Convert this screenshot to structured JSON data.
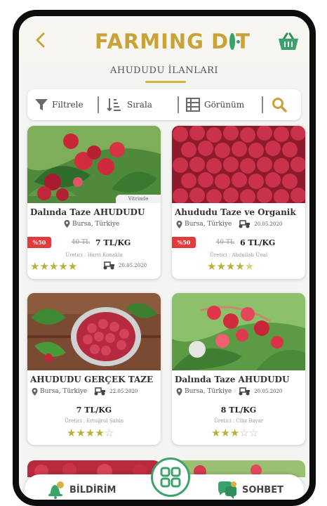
{
  "header": {
    "logo_part1": "FARMING",
    "logo_part2": "D",
    "logo_part3": "T"
  },
  "subtitle": "AHUDUDU İLANLARI",
  "toolbar": {
    "filter_label": "Filtrele",
    "sort_label": "Sırala",
    "view_label": "Görünüm"
  },
  "listings": [
    {
      "title": "Dalında Taze AHUDUDU",
      "location": "Bursa, Türkiye",
      "badge": "%50",
      "old_price": "40 TL",
      "price": "7 TL/KG",
      "seller": "Üretici : Harri Konakla",
      "date": "20.05.2020",
      "rating": 5,
      "showcase_label": "Vitrinde"
    },
    {
      "title": "Ahududu Taze ve Organik",
      "location": "Bursa, Türkiye",
      "badge": "%50",
      "old_price": "40 TL",
      "price": "6 TL/KG",
      "seller": "Üretici : Abdullah Ünal",
      "date": "20.05.2020",
      "rating": 4.5
    },
    {
      "title": "AHUDUDU GERÇEK TAZE",
      "location": "Bursa, Türkiye",
      "price": "7 TL/KG",
      "seller": "Üretici : Ertuğrul Şahin",
      "date": "22.05.2020",
      "rating": 4
    },
    {
      "title": "Dalında Taze AHUDUDU",
      "location": "Bursa, Türkiye",
      "price": "8 TL/KG",
      "seller": "Üretici : Cihz Bayar",
      "date": "20.05.2020",
      "rating": 3
    }
  ],
  "bottombar": {
    "notify_label": "BİLDİRİM",
    "chat_label": "SOHBET"
  },
  "colors": {
    "accent_gold": "#c9a33a",
    "accent_green": "#3aa36b",
    "badge_red": "#e23b3b",
    "star": "#b9b03a"
  }
}
